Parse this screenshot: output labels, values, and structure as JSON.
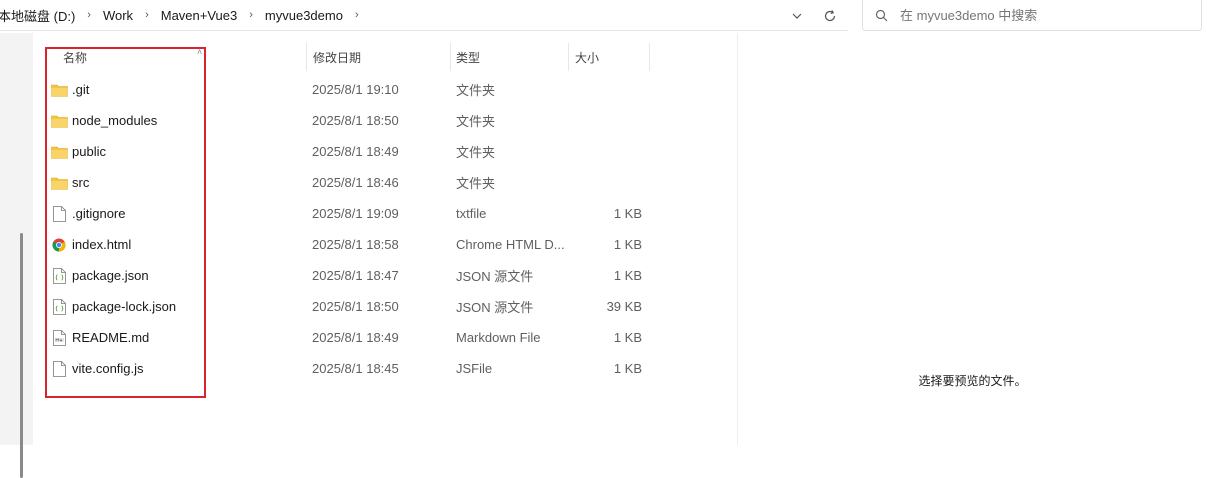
{
  "address_bar": {
    "breadcrumbs": [
      "本地磁盘 (D:)",
      "Work",
      "Maven+Vue3",
      "myvue3demo"
    ],
    "dropdown_icon": "chevron-down-icon",
    "refresh_icon": "refresh-icon"
  },
  "search": {
    "placeholder": "在 myvue3demo 中搜索",
    "icon": "search-icon"
  },
  "columns": {
    "name": "名称",
    "date": "修改日期",
    "type": "类型",
    "size": "大小"
  },
  "files": [
    {
      "name": ".git",
      "date": "2025/8/1 19:10",
      "type": "文件夹",
      "size": "",
      "icon": "folder-icon"
    },
    {
      "name": "node_modules",
      "date": "2025/8/1 18:50",
      "type": "文件夹",
      "size": "",
      "icon": "folder-icon"
    },
    {
      "name": "public",
      "date": "2025/8/1 18:49",
      "type": "文件夹",
      "size": "",
      "icon": "folder-icon"
    },
    {
      "name": "src",
      "date": "2025/8/1 18:46",
      "type": "文件夹",
      "size": "",
      "icon": "folder-icon"
    },
    {
      "name": ".gitignore",
      "date": "2025/8/1 19:09",
      "type": "txtfile",
      "size": "1 KB",
      "icon": "file-icon"
    },
    {
      "name": "index.html",
      "date": "2025/8/1 18:58",
      "type": "Chrome HTML D...",
      "size": "1 KB",
      "icon": "chrome-html-icon"
    },
    {
      "name": "package.json",
      "date": "2025/8/1 18:47",
      "type": "JSON 源文件",
      "size": "1 KB",
      "icon": "json-file-icon"
    },
    {
      "name": "package-lock.json",
      "date": "2025/8/1 18:50",
      "type": "JSON 源文件",
      "size": "39 KB",
      "icon": "json-file-icon"
    },
    {
      "name": "README.md",
      "date": "2025/8/1 18:49",
      "type": "Markdown File",
      "size": "1 KB",
      "icon": "markdown-file-icon"
    },
    {
      "name": "vite.config.js",
      "date": "2025/8/1 18:45",
      "type": "JSFile",
      "size": "1 KB",
      "icon": "file-icon"
    }
  ],
  "preview": {
    "message": "选择要预览的文件。"
  },
  "colors": {
    "highlight": "#d9232e",
    "folder": "#f4c542"
  }
}
